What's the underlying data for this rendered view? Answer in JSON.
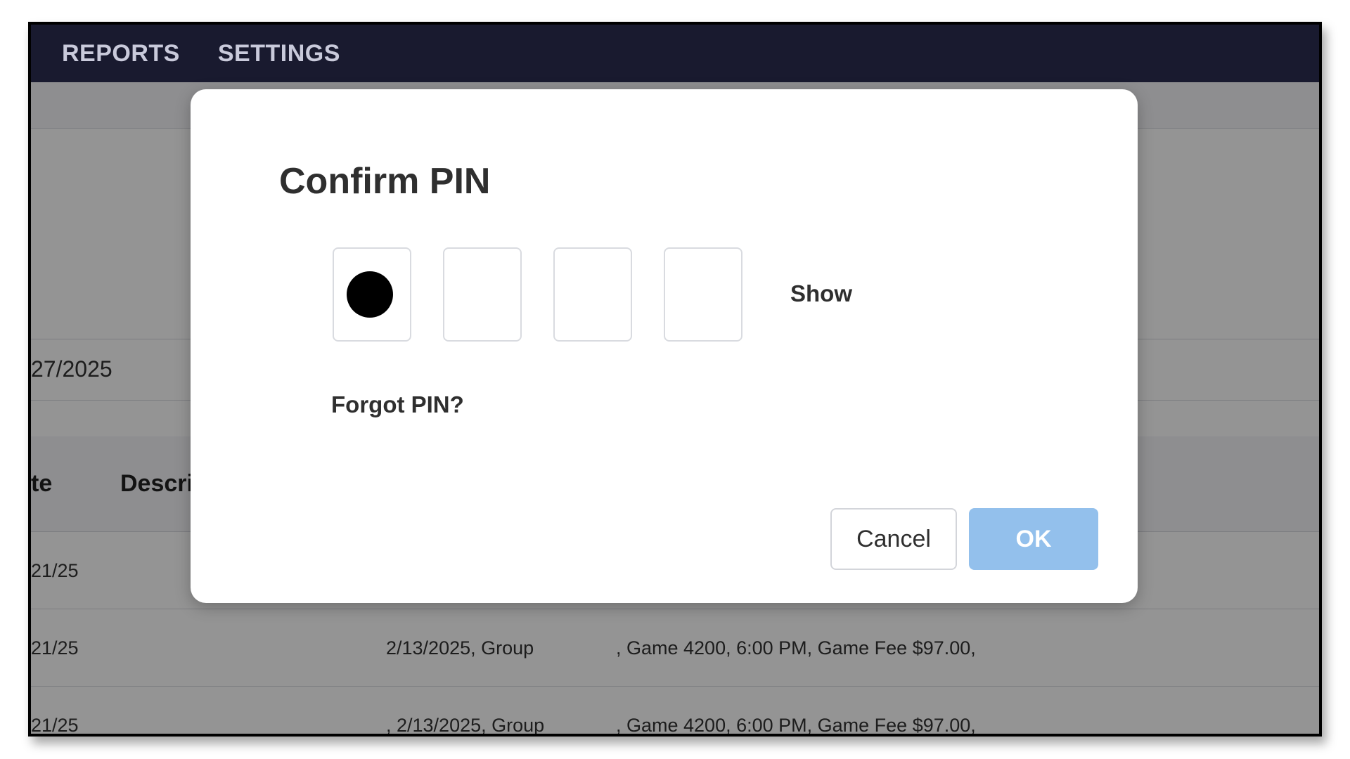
{
  "nav": {
    "items": [
      "REPORTS",
      "SETTINGS"
    ]
  },
  "background": {
    "date_filter": "27/2025",
    "table": {
      "headers": [
        "te",
        "Descri"
      ],
      "rows": [
        {
          "date": "21/25",
          "desc_a": "",
          "desc_b": ""
        },
        {
          "date": "21/25",
          "desc_a": "2/13/2025, Group",
          "desc_b": ", Game 4200, 6:00 PM, Game Fee $97.00,"
        },
        {
          "date": "21/25",
          "desc_a": ", 2/13/2025, Group",
          "desc_b": ", Game 4200, 6:00 PM, Game Fee $97.00,"
        }
      ]
    }
  },
  "modal": {
    "title": "Confirm PIN",
    "pin": {
      "length": 4,
      "filled": 1
    },
    "show_label": "Show",
    "forgot_label": "Forgot PIN?",
    "buttons": {
      "cancel": "Cancel",
      "ok": "OK"
    }
  },
  "colors": {
    "nav_bg": "#191a2f",
    "ok_button": "#93c0ec",
    "overlay": "rgba(0,0,0,0.42)"
  }
}
